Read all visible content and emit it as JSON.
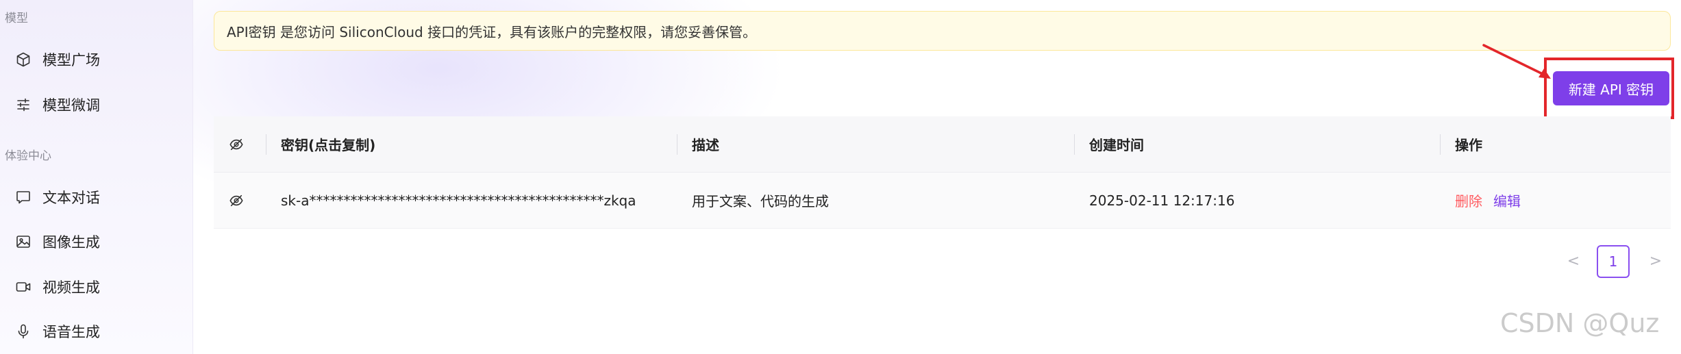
{
  "sidebar": {
    "sections": [
      {
        "label": "模型",
        "items": [
          {
            "label": "模型广场",
            "icon": "cube-icon"
          },
          {
            "label": "模型微调",
            "icon": "sliders-icon"
          }
        ]
      },
      {
        "label": "体验中心",
        "items": [
          {
            "label": "文本对话",
            "icon": "chat-bubble-icon"
          },
          {
            "label": "图像生成",
            "icon": "image-icon"
          },
          {
            "label": "视频生成",
            "icon": "video-camera-icon"
          },
          {
            "label": "语音生成",
            "icon": "microphone-icon"
          }
        ]
      }
    ]
  },
  "notice": {
    "text": "API密钥 是您访问 SiliconCloud 接口的凭证，具有该账户的完整权限，请您妥善保管。"
  },
  "toolbar": {
    "new_key_label": "新建 API 密钥"
  },
  "table": {
    "columns": [
      "密钥(点击复制)",
      "描述",
      "创建时间",
      "操作"
    ],
    "rows": [
      {
        "key": "sk-a*******************************************zkqa",
        "description": "用于文案、代码的生成",
        "created_at": "2025-02-11 12:17:16",
        "actions": {
          "delete": "删除",
          "edit": "编辑"
        }
      }
    ]
  },
  "pagination": {
    "prev": "<",
    "current": "1",
    "next": ">"
  },
  "watermark": "CSDN @Quz",
  "colors": {
    "accent": "#7e3fe9",
    "highlight_box": "#e3262b",
    "delete": "#ff5a5f",
    "notice_bg": "#fffbe6"
  }
}
